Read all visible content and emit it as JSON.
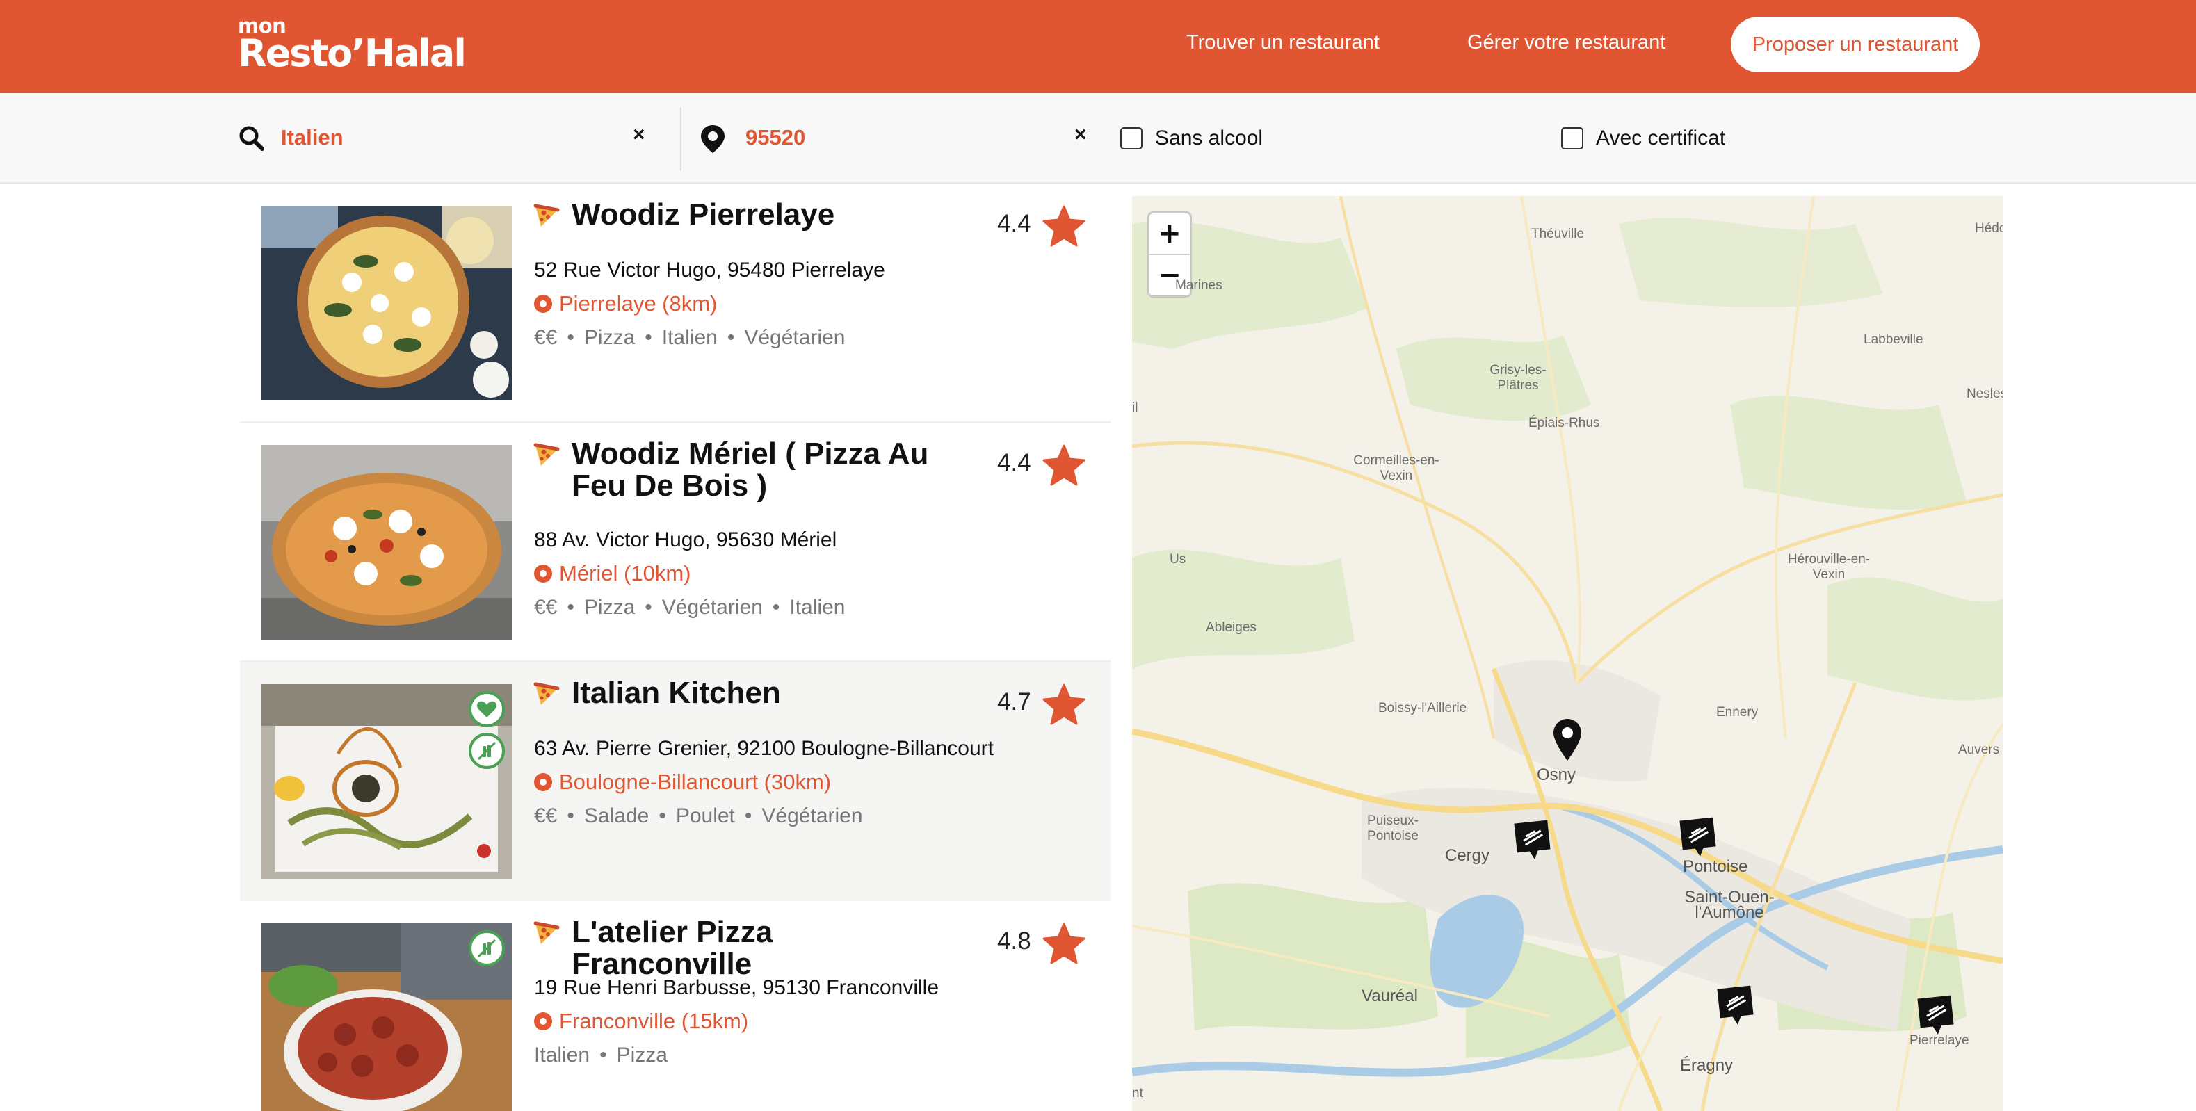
{
  "header": {
    "logo_small": "mon",
    "logo_brand": "Resto’Halal",
    "nav": [
      {
        "label": "Trouver un restaurant"
      },
      {
        "label": "Gérer votre restaurant"
      }
    ],
    "cta_label": "Proposer un restaurant"
  },
  "search": {
    "query": "Italien",
    "location": "95520",
    "clear_symbol": "×",
    "filters": [
      {
        "label": "Sans alcool",
        "checked": false
      },
      {
        "label": "Avec certificat",
        "checked": false
      }
    ]
  },
  "restaurants": [
    {
      "name": "Woodiz Pierrelaye",
      "rating": "4.4",
      "address": "52 Rue Victor Hugo, 95480 Pierrelaye",
      "distance": "Pierrelaye (8km)",
      "price": "€€",
      "tags": [
        "Pizza",
        "Italien",
        "Végétarien"
      ],
      "badges": []
    },
    {
      "name": "Woodiz Mériel ( Pizza Au Feu De Bois )",
      "rating": "4.4",
      "address": "88 Av. Victor Hugo, 95630 Mériel",
      "distance": "Mériel (10km)",
      "price": "€€",
      "tags": [
        "Pizza",
        "Végétarien",
        "Italien"
      ],
      "badges": []
    },
    {
      "name": "Italian Kitchen",
      "rating": "4.7",
      "address": "63 Av. Pierre Grenier, 92100 Boulogne-Billancourt",
      "distance": "Boulogne-Billancourt (30km)",
      "price": "€€",
      "tags": [
        "Salade",
        "Poulet",
        "Végétarien"
      ],
      "badges": [
        "heart-badge-icon",
        "no-alcohol-badge-icon"
      ]
    },
    {
      "name": "L'atelier Pizza Franconville",
      "rating": "4.8",
      "address": "19 Rue Henri Barbusse, 95130 Franconville",
      "distance": "Franconville (15km)",
      "price": "",
      "tags": [
        "Italien",
        "Pizza"
      ],
      "badges": [
        "no-alcohol-badge-icon"
      ]
    }
  ],
  "map": {
    "zoom_in": "+",
    "zoom_out": "−",
    "places": [
      "Théuville",
      "Hédo",
      "Marines",
      "Labbeville",
      "Grisy-les-Plâtres",
      "Nesles-",
      "Épiais-Rhus",
      "il",
      "Cormeilles-en-Vexin",
      "Us",
      "Hérouville-en-Vexin",
      "Ableiges",
      "Boissy-l'Aillerie",
      "Ennery",
      "Osny",
      "Auvers",
      "Puiseux-Pontoise",
      "Cergy",
      "Pontoise",
      "Saint-Ouen-l'Aumône",
      "Vauréal",
      "Éragny",
      "Pierrelaye",
      "nt"
    ],
    "colors": {
      "land": "#f4f1e8",
      "green": "#dde8c4",
      "water": "#a9cbe6",
      "road": "#f7d98a",
      "marker": "#111111"
    }
  },
  "colors": {
    "brand": "#e05532",
    "highlight_row": "#f5f5f3",
    "badge_green": "#4aa054"
  }
}
